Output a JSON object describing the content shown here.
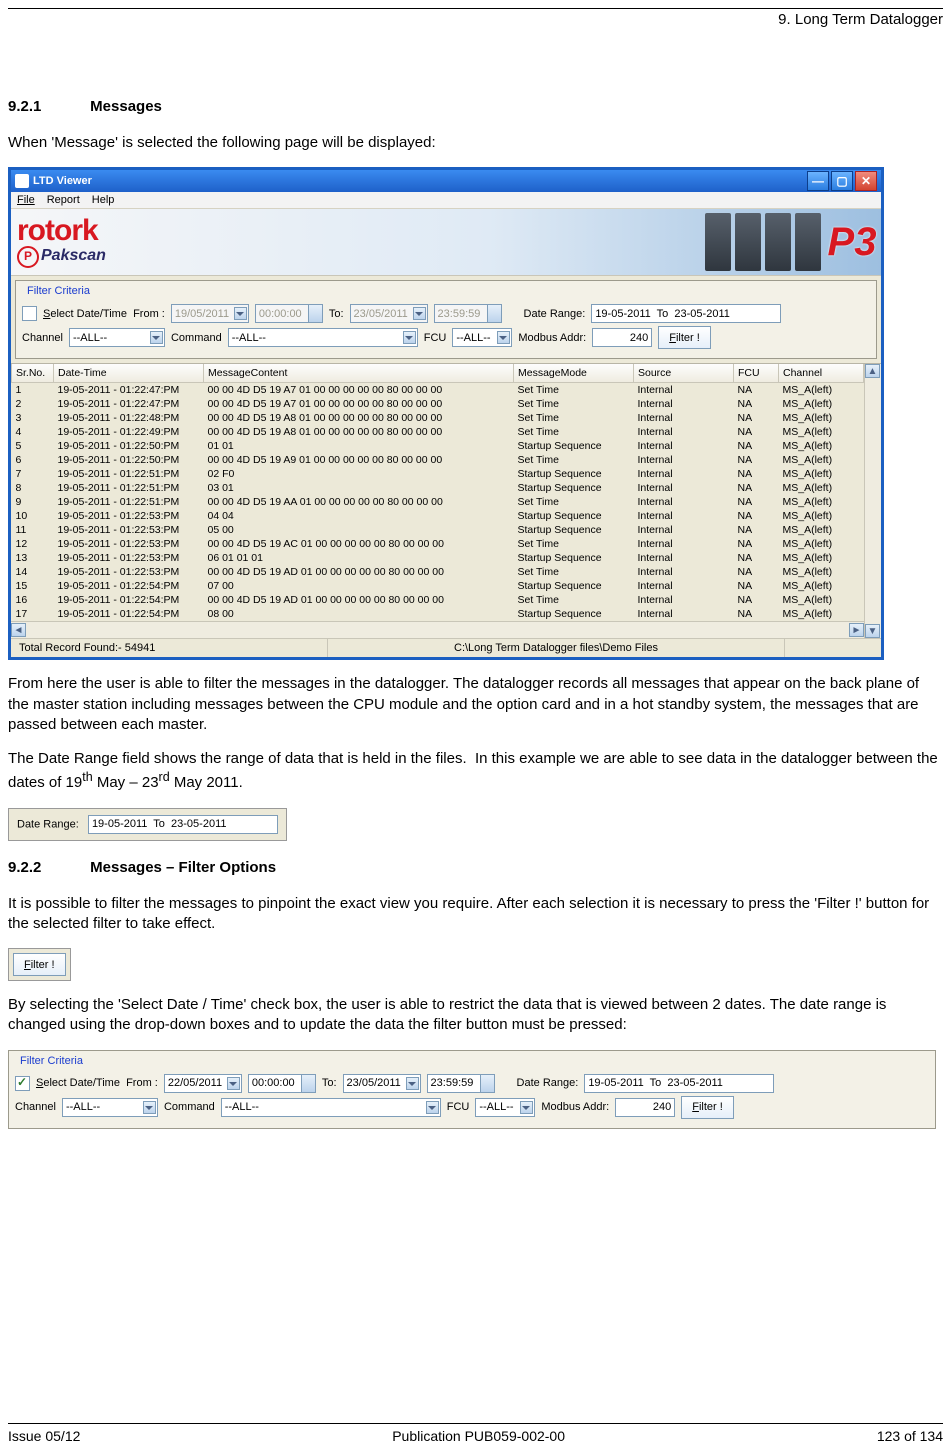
{
  "page_header": {
    "chapter": "9. Long Term Datalogger"
  },
  "sections": {
    "s921_num": "9.2.1",
    "s921_title": "Messages",
    "s922_num": "9.2.2",
    "s922_title": "Messages – Filter Options"
  },
  "paragraphs": {
    "intro": "When 'Message' is selected the following page will be displayed:",
    "after_win": "From here the user is able to filter the messages in the datalogger.  The datalogger records all messages that appear on the back plane of the master station including messages between the CPU module and the option card and in a hot standby system, the messages that are passed between each master.",
    "daterange_para": "The Date Range field shows the range of data that is held in the files.  In this example we are able to see data in the datalogger between the dates of 19th May – 23rd May 2011.",
    "filter_intro": "It is possible to filter the messages to pinpoint the exact view you require.  After each selection it is necessary to press the 'Filter !' button for the selected filter to take effect.",
    "select_date_para": "By selecting the 'Select Date / Time' check box, the user is able to restrict the data that is viewed between 2 dates.  The date range is changed using the drop-down boxes and to update the data the filter button must be pressed:"
  },
  "window": {
    "title": "LTD Viewer",
    "menus": [
      "File",
      "Report",
      "Help"
    ],
    "brand_top": "rotork",
    "brand_sub": "Pakscan",
    "p3": "P3"
  },
  "filter1": {
    "legend": "Filter Criteria",
    "select_dt_label": "Select Date/Time   From :",
    "from_date": "19/05/2011",
    "from_time": "00:00:00",
    "to_label": "To:",
    "to_date": "23/05/2011",
    "to_time": "23:59:59",
    "date_range_label": "Date Range:",
    "date_range_value": "19-05-2011  To  23-05-2011",
    "channel_label": "Channel",
    "channel_value": "--ALL--",
    "command_label": "Command",
    "command_value": "--ALL--",
    "fcu_label": "FCU",
    "fcu_value": "--ALL--",
    "modbus_label": "Modbus Addr:",
    "modbus_value": "240",
    "filter_btn": "Filter !"
  },
  "grid": {
    "headers": [
      "Sr.No.",
      "Date-Time",
      "MessageContent",
      "MessageMode",
      "Source",
      "FCU",
      "Channel"
    ],
    "rows": [
      [
        "1",
        "19-05-2011 - 01:22:47:PM",
        "00 00 4D D5 19 A7 01 00 00 00 00 00 80 00 00 00",
        "Set Time",
        "Internal",
        "NA",
        "MS_A(left)"
      ],
      [
        "2",
        "19-05-2011 - 01:22:47:PM",
        "00 00 4D D5 19 A7 01 00 00 00 00 00 80 00 00 00",
        "Set Time",
        "Internal",
        "NA",
        "MS_A(left)"
      ],
      [
        "3",
        "19-05-2011 - 01:22:48:PM",
        "00 00 4D D5 19 A8 01 00 00 00 00 00 80 00 00 00",
        "Set Time",
        "Internal",
        "NA",
        "MS_A(left)"
      ],
      [
        "4",
        "19-05-2011 - 01:22:49:PM",
        "00 00 4D D5 19 A8 01 00 00 00 00 00 80 00 00 00",
        "Set Time",
        "Internal",
        "NA",
        "MS_A(left)"
      ],
      [
        "5",
        "19-05-2011 - 01:22:50:PM",
        "01 01",
        "Startup Sequence",
        "Internal",
        "NA",
        "MS_A(left)"
      ],
      [
        "6",
        "19-05-2011 - 01:22:50:PM",
        "00 00 4D D5 19 A9 01 00 00 00 00 00 80 00 00 00",
        "Set Time",
        "Internal",
        "NA",
        "MS_A(left)"
      ],
      [
        "7",
        "19-05-2011 - 01:22:51:PM",
        "02 F0",
        "Startup Sequence",
        "Internal",
        "NA",
        "MS_A(left)"
      ],
      [
        "8",
        "19-05-2011 - 01:22:51:PM",
        "03 01",
        "Startup Sequence",
        "Internal",
        "NA",
        "MS_A(left)"
      ],
      [
        "9",
        "19-05-2011 - 01:22:51:PM",
        "00 00 4D D5 19 AA 01 00 00 00 00 00 80 00 00 00",
        "Set Time",
        "Internal",
        "NA",
        "MS_A(left)"
      ],
      [
        "10",
        "19-05-2011 - 01:22:53:PM",
        "04 04",
        "Startup Sequence",
        "Internal",
        "NA",
        "MS_A(left)"
      ],
      [
        "11",
        "19-05-2011 - 01:22:53:PM",
        "05 00",
        "Startup Sequence",
        "Internal",
        "NA",
        "MS_A(left)"
      ],
      [
        "12",
        "19-05-2011 - 01:22:53:PM",
        "00 00 4D D5 19 AC 01 00 00 00 00 00 80 00 00 00",
        "Set Time",
        "Internal",
        "NA",
        "MS_A(left)"
      ],
      [
        "13",
        "19-05-2011 - 01:22:53:PM",
        "06 01 01 01",
        "Startup Sequence",
        "Internal",
        "NA",
        "MS_A(left)"
      ],
      [
        "14",
        "19-05-2011 - 01:22:53:PM",
        "00 00 4D D5 19 AD 01 00 00 00 00 00 80 00 00 00",
        "Set Time",
        "Internal",
        "NA",
        "MS_A(left)"
      ],
      [
        "15",
        "19-05-2011 - 01:22:54:PM",
        "07 00",
        "Startup Sequence",
        "Internal",
        "NA",
        "MS_A(left)"
      ],
      [
        "16",
        "19-05-2011 - 01:22:54:PM",
        "00 00 4D D5 19 AD 01 00 00 00 00 00 80 00 00 00",
        "Set Time",
        "Internal",
        "NA",
        "MS_A(left)"
      ],
      [
        "17",
        "19-05-2011 - 01:22:54:PM",
        "08 00",
        "Startup Sequence",
        "Internal",
        "NA",
        "MS_A(left)"
      ]
    ],
    "status_left": "Total Record Found:- 54941",
    "status_mid": "C:\\Long Term Datalogger files\\Demo Files"
  },
  "crop_daterange": {
    "label": "Date Range:",
    "value": "19-05-2011  To  23-05-2011"
  },
  "crop_filterbtn": "Filter !",
  "filter2": {
    "legend": "Filter Criteria",
    "select_dt_label": "Select Date/Time   From :",
    "from_date": "22/05/2011",
    "from_time": "00:00:00",
    "to_label": "To:",
    "to_date": "23/05/2011",
    "to_time": "23:59:59",
    "date_range_label": "Date Range:",
    "date_range_value": "19-05-2011  To  23-05-2011",
    "channel_label": "Channel",
    "channel_value": "--ALL--",
    "command_label": "Command",
    "command_value": "--ALL--",
    "fcu_label": "FCU",
    "fcu_value": "--ALL--",
    "modbus_label": "Modbus Addr:",
    "modbus_value": "240",
    "filter_btn": "Filter !"
  },
  "footer": {
    "left": "Issue 05/12",
    "center": "Publication PUB059-002-00",
    "right": "123 of 134"
  }
}
